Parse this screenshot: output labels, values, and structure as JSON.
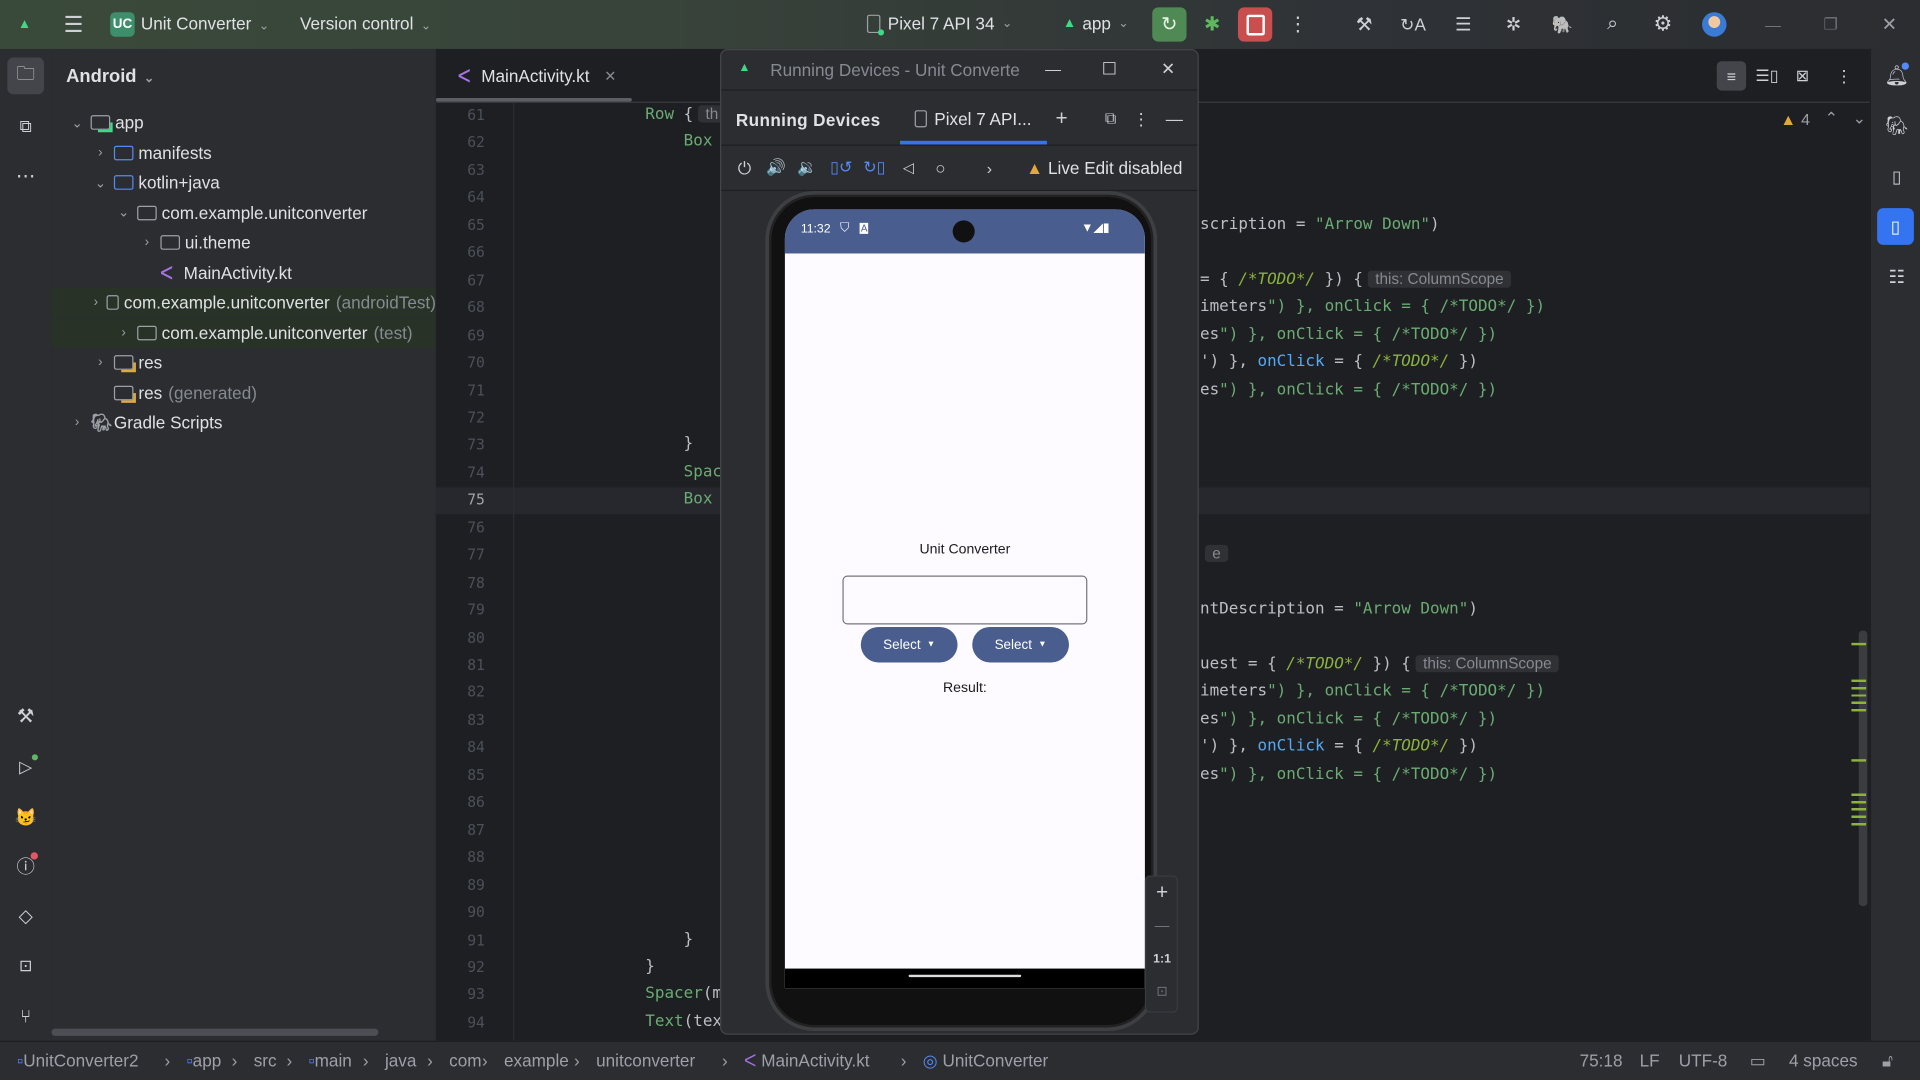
{
  "topbar": {
    "project_badge": "UC",
    "project_name": "Unit Converter",
    "vcs": "Version control",
    "device": "Pixel 7 API 34",
    "run_config": "app",
    "colors": {
      "rerun": "#4f8a55",
      "stop": "#c94f4f",
      "badge": "#3d8f6c"
    }
  },
  "left_strip": {
    "icons": [
      "folder-icon",
      "structure-icon",
      "more-icon",
      "build-icon",
      "run-icon",
      "app-quality-icon",
      "problems-icon",
      "gem-icon",
      "terminal-icon",
      "git-icon"
    ]
  },
  "right_strip": {
    "icons": [
      "notifications-icon",
      "gradle-icon",
      "device-manager-icon",
      "running-devices-icon",
      "structure-list-icon"
    ]
  },
  "project": {
    "view": "Android",
    "tree": [
      {
        "label": "app",
        "depth": 0,
        "expanded": true,
        "icon": "module"
      },
      {
        "label": "manifests",
        "depth": 1,
        "expanded": false,
        "icon": "folder-blue"
      },
      {
        "label": "kotlin+java",
        "depth": 1,
        "expanded": true,
        "icon": "folder-blue"
      },
      {
        "label": "com.example.unitconverter",
        "depth": 2,
        "expanded": true,
        "icon": "package"
      },
      {
        "label": "ui.theme",
        "depth": 3,
        "expanded": false,
        "icon": "package"
      },
      {
        "label": "MainActivity.kt",
        "depth": 3,
        "icon": "kotlin"
      },
      {
        "label": "com.example.unitconverter",
        "suffix": "(androidTest)",
        "depth": 2,
        "expanded": false,
        "icon": "package",
        "highlight": true
      },
      {
        "label": "com.example.unitconverter",
        "suffix": "(test)",
        "depth": 2,
        "expanded": false,
        "icon": "package",
        "highlight": true
      },
      {
        "label": "res",
        "depth": 1,
        "expanded": false,
        "icon": "res"
      },
      {
        "label": "res",
        "suffix": "(generated)",
        "depth": 1,
        "icon": "res"
      },
      {
        "label": "Gradle Scripts",
        "depth": 0,
        "expanded": false,
        "icon": "gradle"
      }
    ]
  },
  "editor": {
    "tab": "MainActivity.kt",
    "warnings": "4",
    "current_line": 75,
    "lines": [
      {
        "n": 61,
        "left": "Row {",
        "left_hint": "th"
      },
      {
        "n": 62,
        "left": "    Box"
      },
      {
        "n": 63
      },
      {
        "n": 64
      },
      {
        "n": 65,
        "right": "scription = \"Arrow Down\")"
      },
      {
        "n": 66
      },
      {
        "n": 67,
        "right": "= { /*TODO*/ }) {",
        "right_hint": "this: ColumnScope"
      },
      {
        "n": 68,
        "right": "imeters\") }, onClick = { /*TODO*/ })"
      },
      {
        "n": 69,
        "right": "es\") }, onClick = { /*TODO*/ })"
      },
      {
        "n": 70,
        "right": "') }, onClick = { /*TODO*/ })"
      },
      {
        "n": 71,
        "right": "es\") }, onClick = { /*TODO*/ })"
      },
      {
        "n": 72
      },
      {
        "n": 73,
        "left": "    }"
      },
      {
        "n": 74,
        "left": "    Spac"
      },
      {
        "n": 75,
        "left": "    Box"
      },
      {
        "n": 76
      },
      {
        "n": 77,
        "right_hint": "e"
      },
      {
        "n": 78
      },
      {
        "n": 79,
        "right": "ntDescription = \"Arrow Down\")"
      },
      {
        "n": 80
      },
      {
        "n": 81,
        "right": "uest = { /*TODO*/ }) {",
        "right_hint": "this: ColumnScope"
      },
      {
        "n": 82,
        "right": "imeters\") }, onClick = { /*TODO*/ })"
      },
      {
        "n": 83,
        "right": "es\") }, onClick = { /*TODO*/ })"
      },
      {
        "n": 84,
        "right": "') }, onClick = { /*TODO*/ })"
      },
      {
        "n": 85,
        "right": "es\") }, onClick = { /*TODO*/ })"
      },
      {
        "n": 86
      },
      {
        "n": 87
      },
      {
        "n": 88
      },
      {
        "n": 89
      },
      {
        "n": 90
      },
      {
        "n": 91,
        "left": "    }"
      },
      {
        "n": 92,
        "left": "}"
      },
      {
        "n": 93,
        "left": "Spacer(m"
      },
      {
        "n": 94,
        "left": "Text(tex"
      }
    ]
  },
  "running_devices": {
    "window_title": "Running Devices - Unit Converte",
    "panel_title": "Running Devices",
    "device_tab": "Pixel 7 API...",
    "live_edit": "Live Edit disabled",
    "zoom_reset": "1:1",
    "phone": {
      "time": "11:32",
      "app_title": "Unit Converter",
      "input_value": "",
      "select_1": "Select",
      "select_2": "Select",
      "result": "Result:",
      "colors": {
        "primary": "#4a5d8f",
        "background": "#fdfbff"
      }
    }
  },
  "statusbar": {
    "breadcrumbs": [
      "UnitConverter2",
      "app",
      "src",
      "main",
      "java",
      "com",
      "example",
      "unitconverter",
      "MainActivity.kt",
      "UnitConverter"
    ],
    "position": "75:18",
    "line_sep": "LF",
    "encoding": "UTF-8",
    "indent": "4 spaces"
  }
}
